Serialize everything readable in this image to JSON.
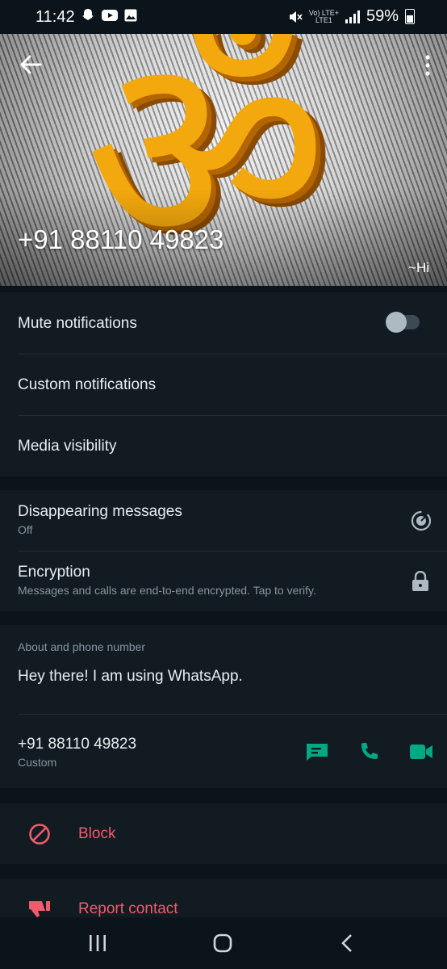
{
  "status_bar": {
    "time": "11:42",
    "network_top": "Vo) LTE+",
    "network_bottom": "LTE1",
    "battery": "59%"
  },
  "header": {
    "phone": "+91 88110 49823",
    "status": "~Hi",
    "profile_glyph": "ॐ"
  },
  "settings": {
    "mute": {
      "label": "Mute notifications",
      "enabled": false
    },
    "custom_notifications": "Custom notifications",
    "media_visibility": "Media visibility"
  },
  "privacy": {
    "disappearing_label": "Disappearing messages",
    "disappearing_value": "Off",
    "encryption_label": "Encryption",
    "encryption_desc": "Messages and calls are end-to-end encrypted. Tap to verify."
  },
  "about": {
    "heading": "About and phone number",
    "text": "Hey there! I am using WhatsApp.",
    "phone": "+91 88110 49823",
    "phone_type": "Custom"
  },
  "actions": {
    "block": "Block",
    "report": "Report contact"
  },
  "colors": {
    "accent": "#00a884",
    "danger": "#f15c6d",
    "background": "#0b141a",
    "panel": "#111b21"
  }
}
